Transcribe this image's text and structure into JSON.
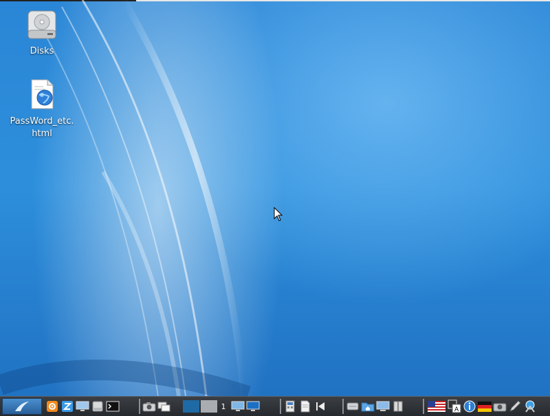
{
  "desktop": {
    "icons": [
      {
        "label": "Disks",
        "icon": "hard-disk-icon"
      },
      {
        "label_line1": "PassWord_etc.",
        "label_line2": "html",
        "icon": "html-file-icon"
      }
    ]
  },
  "taskbar": {
    "workspace_number": "1",
    "launchers": [
      "start-menu-icon",
      "settings-icon",
      "file-manager-icon",
      "desktop-icon",
      "disk-icon",
      "terminal-icon",
      "camera-icon",
      "windows-icon",
      "workspace-1",
      "workspace-2",
      "display-icon",
      "monitor-icon",
      "calculator-icon",
      "document-icon",
      "media-back-icon",
      "drive-icon",
      "home-folder-icon",
      "computer-icon",
      "panel-icon",
      "us-flag-icon",
      "keyboard-layout-icon",
      "info-icon",
      "german-flag-icon",
      "screenshot-icon",
      "pen-icon",
      "network-icon"
    ]
  },
  "colors": {
    "desktop": "#2a86d6",
    "taskbar": "#2a2d31",
    "accent": "#1c7fd6"
  }
}
